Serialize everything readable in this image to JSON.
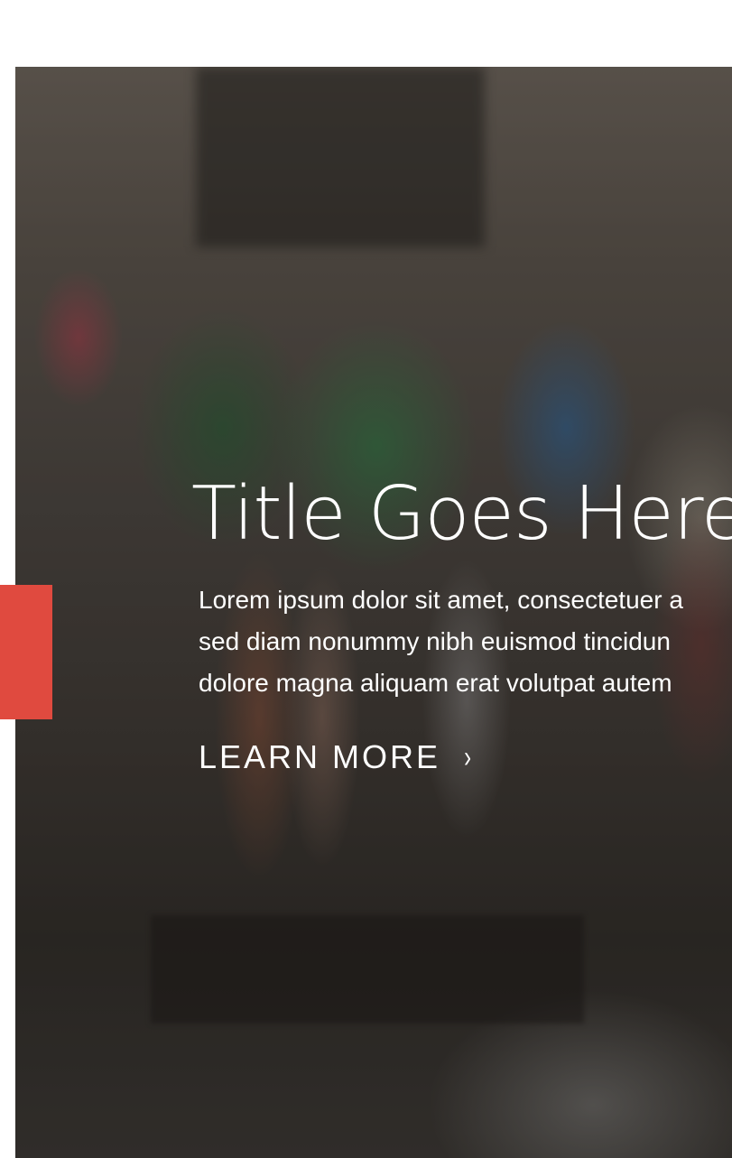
{
  "hero": {
    "title": "Title Goes Here",
    "description_lines": [
      "Lorem ipsum dolor sit amet, consectetuer a",
      "sed diam nonummy nibh euismod tincidun",
      "dolore magna aliquam erat volutpat autem"
    ],
    "cta_label": "LEARN MORE",
    "cta_icon": "chevron-right-icon",
    "background_image": "clothing-store-photo"
  },
  "colors": {
    "accent": "#e04a3f",
    "text": "#ffffff",
    "page_background": "#ffffff"
  }
}
